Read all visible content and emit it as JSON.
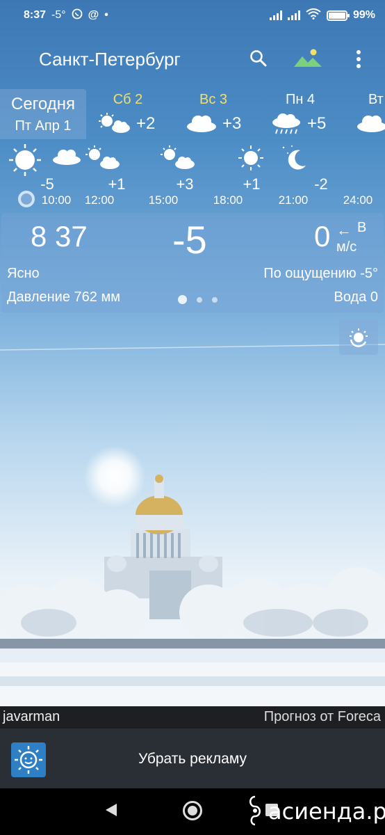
{
  "status_bar": {
    "time": "8:37",
    "temp": "-5°",
    "battery": "99%",
    "battery_level": 0.99
  },
  "app_bar": {
    "city": "Санкт-Петербург"
  },
  "days": [
    {
      "name": "Сегодня",
      "date": "Пт Апр 1",
      "selected": true
    },
    {
      "name": "Сб 2",
      "temp": "+2",
      "icon": "sun-cloud-icon",
      "color": "#f2e06a"
    },
    {
      "name": "Вс 3",
      "temp": "+3",
      "icon": "cloud-icon",
      "color": "#f2e06a"
    },
    {
      "name": "Пн 4",
      "temp": "+5",
      "icon": "rain-cloud-icon"
    },
    {
      "name": "Вт",
      "icon": "cloud-icon"
    }
  ],
  "hourly": [
    {
      "time": "10:00",
      "temp": "-5"
    },
    {
      "time": "12:00",
      "temp": "+1"
    },
    {
      "time": "15:00",
      "temp": "+3"
    },
    {
      "time": "18:00",
      "temp": "+1"
    },
    {
      "time": "21:00",
      "temp": "-2"
    },
    {
      "time": "24:00",
      "temp": ""
    }
  ],
  "current": {
    "time": "8 37",
    "temp": "-5",
    "wind_speed": "0",
    "wind_arrow": "←",
    "wind_dir": "В",
    "wind_unit": "м/с",
    "condition": "Ясно",
    "feels_like": "По ощущению -5°",
    "pressure": "Давление 762 мм",
    "water": "Вода 0",
    "page_index": 1,
    "page_count": 3
  },
  "credits": {
    "author": "javarman",
    "provider": "Прогноз от Foreca"
  },
  "ad": {
    "label": "Убрать рекламу"
  },
  "watermark": {
    "text": "асиенда.ру"
  }
}
